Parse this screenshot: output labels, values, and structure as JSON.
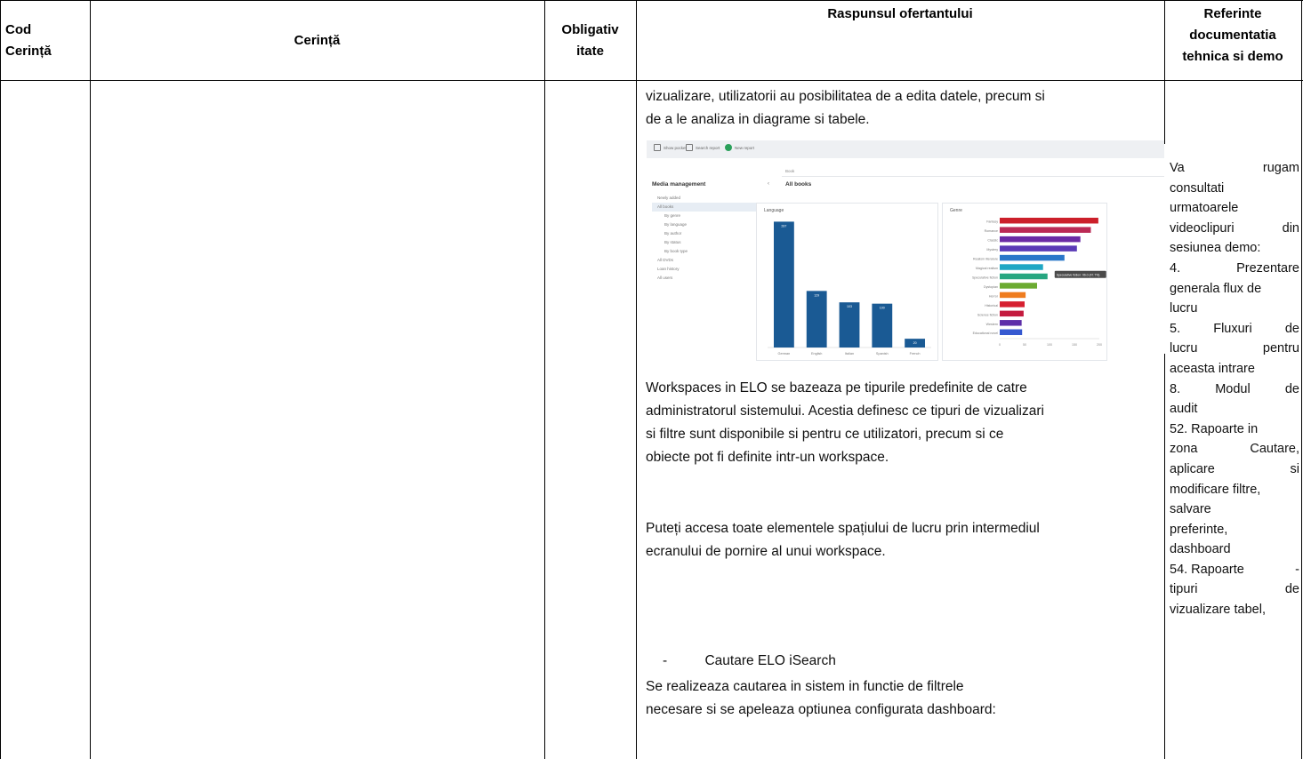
{
  "table": {
    "headers": {
      "cod": [
        "Cod",
        "Cerință"
      ],
      "cerinta": "Cerință",
      "obligativitate": [
        "Obligativ",
        "itate"
      ],
      "raspuns": "Raspunsul ofertantului",
      "referinte": [
        "Referinte",
        "documentatia",
        "tehnica si demo"
      ]
    }
  },
  "response": {
    "intro_lines": [
      "vizualizare, utilizatorii au posibilitatea de a edita datele, precum si",
      "de a le analiza in diagrame si tabele."
    ],
    "workspaces_lines": [
      "Workspaces in ELO se bazeaza pe tipurile predefinite de catre",
      "administratorul sistemului. Acestia definesc ce tipuri de vizualizari",
      "si filtre sunt disponibile si pentru ce utilizatori, precum si ce",
      "obiecte pot fi definite intr-un workspace."
    ],
    "access_lines": [
      "Puteți accesa toate elementele spațiului de lucru prin intermediul",
      "ecranului de pornire al unui workspace."
    ],
    "bullet_dash": "-",
    "bullet_text": "Cautare ELO iSearch",
    "search_lines": [
      "Se realizeaza cautarea in sistem in functie de filtrele",
      "necesare si se apeleaza optiunea configurata dashboard:"
    ]
  },
  "references": {
    "lines": [
      [
        "Va",
        "rugam"
      ],
      [
        "consultati"
      ],
      [
        "urmatoarele"
      ],
      [
        "videoclipuri",
        "din"
      ],
      [
        "sesiunea demo:"
      ],
      [
        "4.",
        "Prezentare"
      ],
      [
        "generala flux de"
      ],
      [
        "lucru"
      ],
      [
        "5.",
        "Fluxuri",
        "de"
      ],
      [
        "lucru",
        "pentru"
      ],
      [
        "aceasta intrare"
      ],
      [
        "8.",
        "Modul",
        "de"
      ],
      [
        "audit"
      ],
      [
        "52. Rapoarte in"
      ],
      [
        "zona",
        "Cautare,"
      ],
      [
        "aplicare",
        "si"
      ],
      [
        "modificare filtre,"
      ],
      [
        "salvare"
      ],
      [
        "preferinte,"
      ],
      [
        "dashboard"
      ],
      [
        "54. Rapoarte",
        "-"
      ],
      [
        "tipuri",
        "de"
      ],
      [
        "vizualizare tabel,"
      ]
    ]
  },
  "screenshot": {
    "toolbar": [
      "Show pocket",
      "Search report",
      "New report"
    ],
    "sidebar_title": "Media management",
    "sidebar_items": [
      "Newly added",
      "All books",
      "By genre",
      "By language",
      "By author",
      "By status",
      "By book type",
      "All DVDs",
      "Loan history",
      "All users"
    ],
    "breadcrumb": "Book",
    "page_title": "All books",
    "tooltip": "Speculative fiction: 96.0 (47.7%)",
    "chart_data": [
      {
        "type": "bar",
        "title": "Language",
        "categories": [
          "German",
          "English",
          "Italian",
          "Spanish",
          "French"
        ],
        "values": [
          287,
          129,
          103,
          100,
          20
        ],
        "value_labels": [
          "287",
          "129",
          "103",
          "100",
          "20"
        ],
        "ylim": [
          0,
          300
        ],
        "color": "#1a5a94"
      },
      {
        "type": "bar",
        "orientation": "horizontal",
        "title": "Genre",
        "categories": [
          "Fantasy",
          "Romance",
          "Classic",
          "Mystery",
          "Realism literature",
          "Magical realism",
          "Speculative fiction",
          "Dystopian",
          "Horror",
          "Historical",
          "Science fiction",
          "Western",
          "Educational novel"
        ],
        "values": [
          198,
          183,
          162,
          155,
          130,
          87,
          96,
          75,
          52,
          50,
          48,
          44,
          45
        ],
        "colors": [
          "#cc1f2a",
          "#bb2a55",
          "#6a2ba5",
          "#5a3ab6",
          "#2a77c9",
          "#1fa7c4",
          "#26a680",
          "#6cab32",
          "#ef7c1e",
          "#d62030",
          "#c41b3e",
          "#5d2ea8",
          "#3558d0"
        ],
        "xticks": [
          "0",
          "50",
          "100",
          "150",
          "200"
        ],
        "xlim": [
          0,
          200
        ]
      }
    ]
  },
  "colors": {
    "border": "#000000"
  }
}
